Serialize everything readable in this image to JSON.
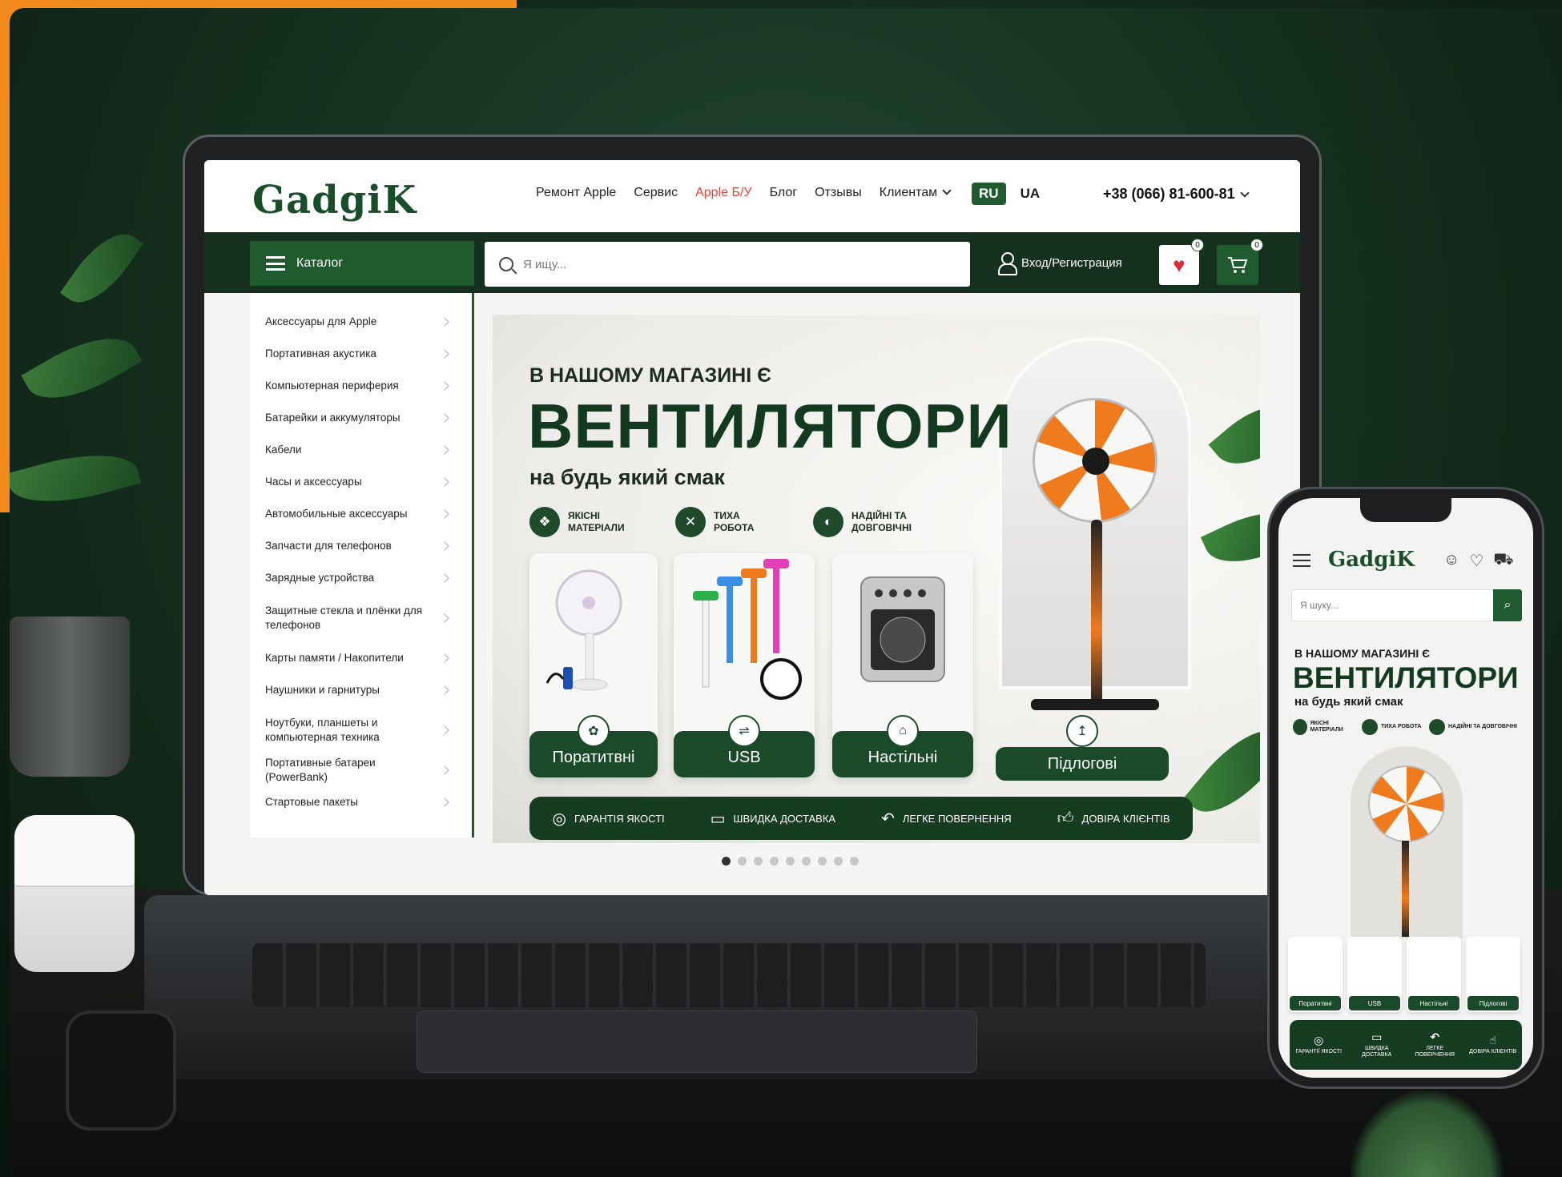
{
  "brand": {
    "logo": "GadgiK",
    "primary_color": "#1f5b2e",
    "accent_color": "#e2433a",
    "fan_color": "#f07b1f"
  },
  "header": {
    "nav": [
      "Ремонт Apple",
      "Сервис",
      "Apple Б/У",
      "Блог",
      "Отзывы",
      "Клиентам"
    ],
    "nav_accent_index": 2,
    "lang_active": "RU",
    "lang_other": "UA",
    "phone": "+38 (066) 81-600-81"
  },
  "toolbar": {
    "catalog_label": "Каталог",
    "search_placeholder": "Я ищу...",
    "login_label": "Вход/Регистрация",
    "favorites_count": "0",
    "cart_count": "0"
  },
  "sidebar": {
    "items": [
      "Аксессуары для Apple",
      "Портативная акустика",
      "Компьютерная периферия",
      "Батарейки и аккумуляторы",
      "Кабели",
      "Часы и аксессуары",
      "Автомобильные аксессуары",
      "Запчасти для телефонов",
      "Зарядные устройства",
      "Защитные стекла и плёнки для телефонов",
      "Карты памяти / Накопители",
      "Наушники и гарнитуры",
      "Ноутбуки, планшеты и компьютерная техника",
      "Портативные батареи (PowerBank)",
      "Стартовые пакеты"
    ]
  },
  "banner": {
    "pre_title": "В НАШОМУ МАГАЗИНІ Є",
    "title": "ВЕНТИЛЯТОРИ",
    "subtitle": "на будь який смак",
    "features": [
      {
        "line1": "ЯКІСНІ",
        "line2": "МАТЕРІАЛИ"
      },
      {
        "line1": "ТИХА",
        "line2": "РОБОТА"
      },
      {
        "line1": "НАДІЙНІ ТА",
        "line2": "ДОВГОВІЧНІ"
      }
    ],
    "categories": [
      "Поратитвні",
      "USB",
      "Настільні",
      "Підлогові"
    ],
    "benefits": [
      "ГАРАНТІЯ ЯКОСТІ",
      "ШВИДКА ДОСТАВКА",
      "ЛЕГКЕ ПОВЕРНЕННЯ",
      "ДОВІРА КЛІЄНТІВ"
    ],
    "slide_count": 9,
    "active_slide": 0
  },
  "mobile": {
    "logo": "GadgiK",
    "search_placeholder": "Я шукy...",
    "pre_title": "В НАШОМУ МАГАЗИНІ Є",
    "title": "ВЕНТИЛЯТОРИ",
    "subtitle": "на будь який смак",
    "features": [
      "ЯКІСНІ МАТЕРІАЛИ",
      "ТИХА РОБОТА",
      "НАДІЙНІ ТА ДОВГОВІЧНІ"
    ],
    "categories": [
      "Поратитвні",
      "USB",
      "Настільні",
      "Підлогові"
    ],
    "benefits": [
      "ГАРАНТІЇ ЯКОСТІ",
      "ШВИДКА ДОСТАВКА",
      "ЛЕГКЕ ПОВЕРНЕННЯ",
      "ДОВІРА КЛІЄНТІВ"
    ]
  }
}
